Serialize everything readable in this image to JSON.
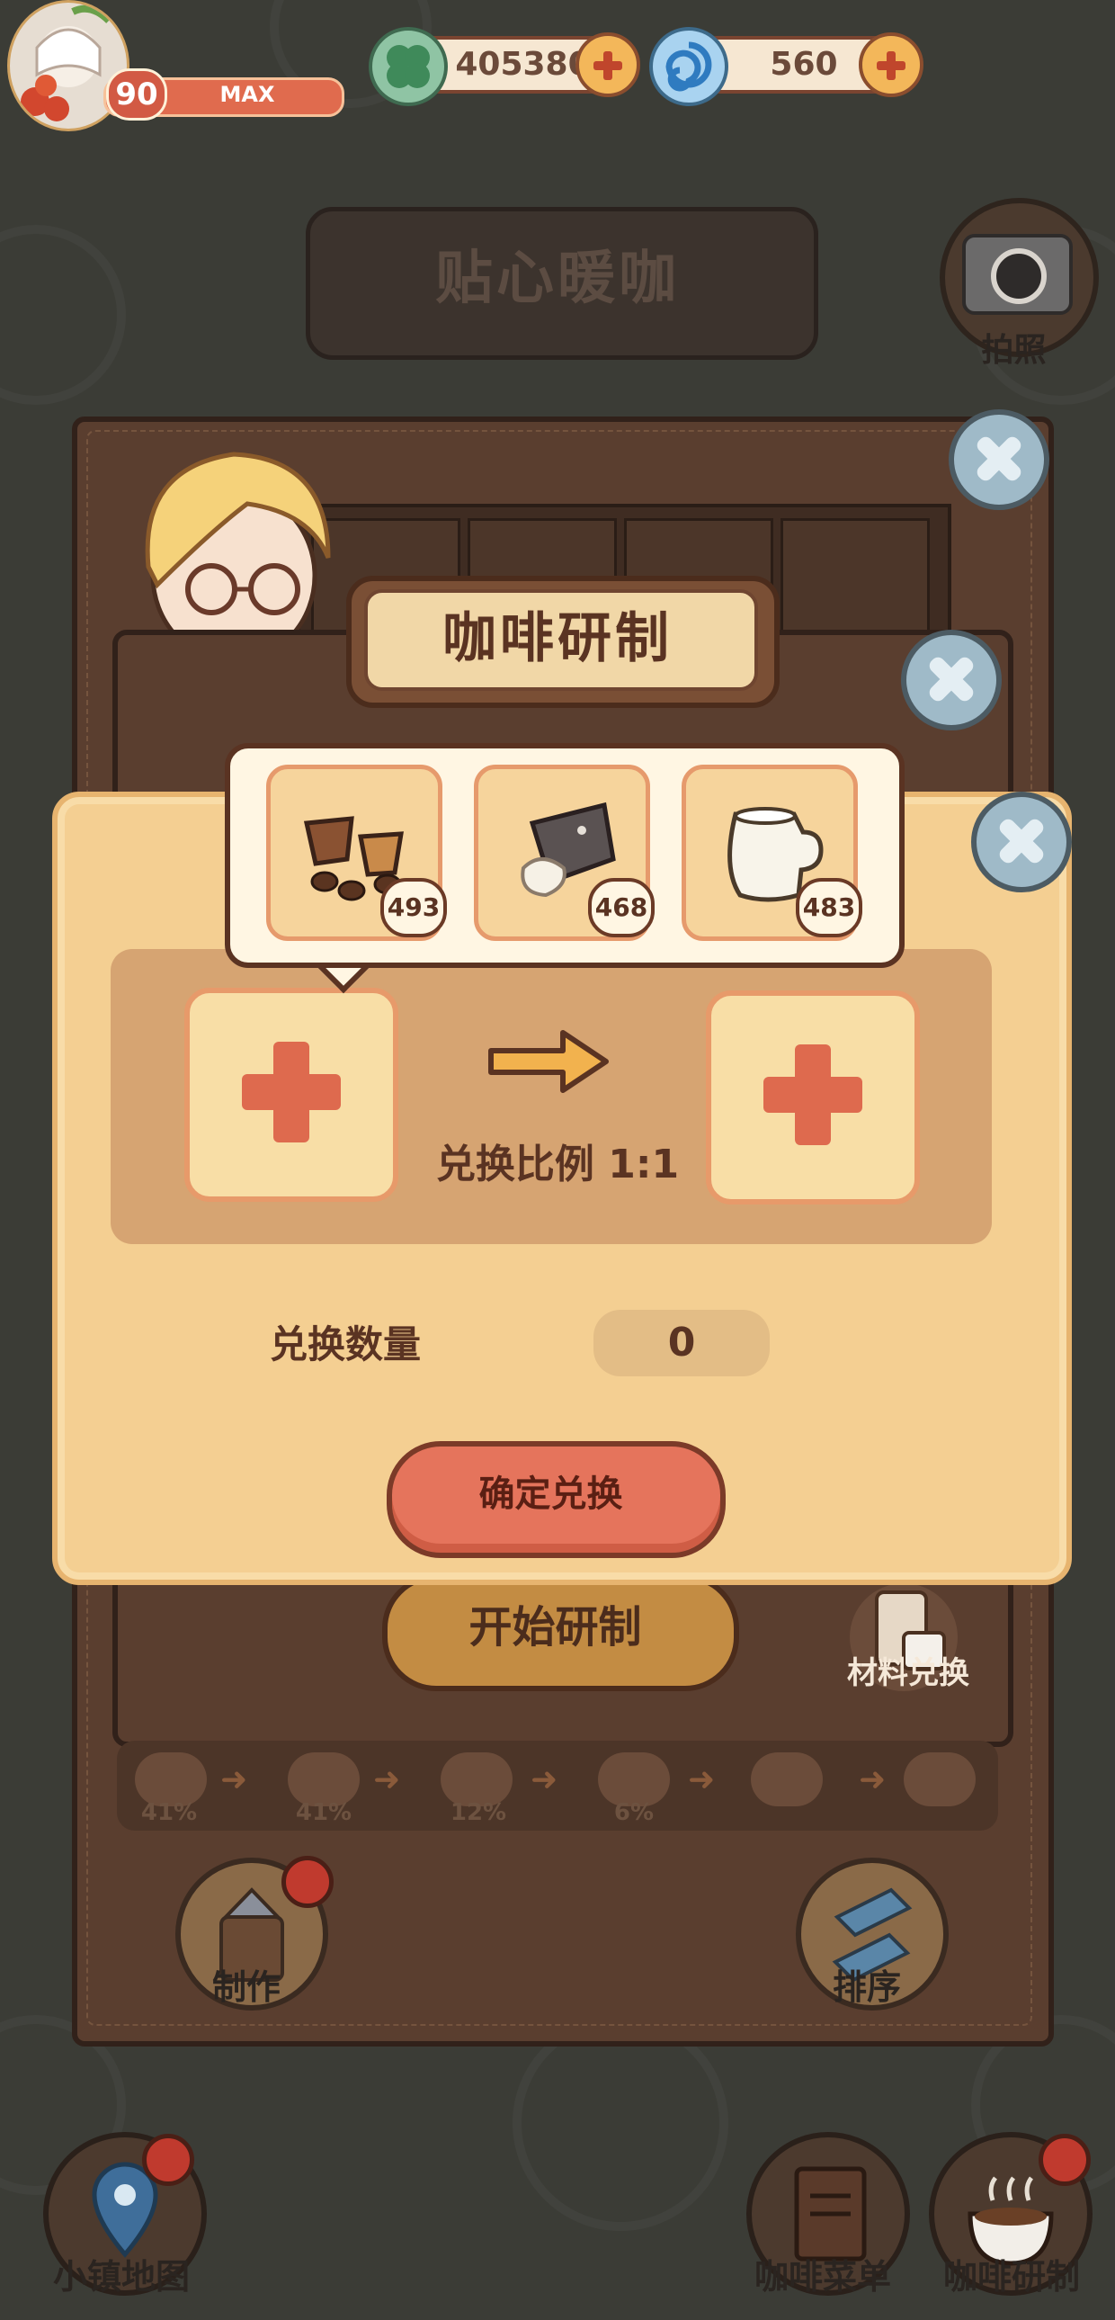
{
  "player": {
    "level": "90",
    "level_status": "MAX"
  },
  "currency": {
    "coins": "405380",
    "gems": "560"
  },
  "shop_sign": "贴心暖咖",
  "camera_label": "拍照",
  "panel_title": "咖啡研制",
  "start_button": "开始研制",
  "material_exchange_label": "材料兑换",
  "process_chain": {
    "percents": [
      "41%",
      "41%",
      "12%",
      "6%"
    ]
  },
  "make_label": "制作",
  "sort_label": "排序",
  "bottom_nav": {
    "town_map": "小镇地图",
    "coffee_menu": "咖啡菜单",
    "coffee_research": "咖啡研制"
  },
  "exchange": {
    "items": [
      {
        "name": "coffee-bean-cup-icon",
        "count": "493"
      },
      {
        "name": "sugar-packet-icon",
        "count": "468"
      },
      {
        "name": "milk-jug-icon",
        "count": "483"
      }
    ],
    "ratio_label": "兑换比例 1:1",
    "quantity_label": "兑换数量",
    "quantity_value": "0",
    "confirm_button": "确定兑换"
  },
  "colors": {
    "dialog_bg": "#f4cf92",
    "confirm": "#e5745c",
    "plus": "#de6a4e"
  }
}
